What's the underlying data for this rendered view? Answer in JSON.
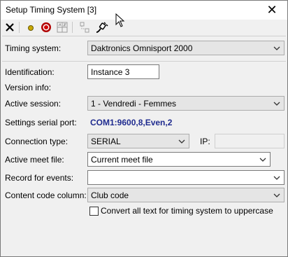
{
  "window": {
    "title": "Setup Timing System [3]"
  },
  "toolbar": {
    "icons": [
      "close-icon",
      "yellow-dot-icon",
      "red-record-icon",
      "number-grid-icon",
      "disconnected-icon",
      "plug-icon"
    ]
  },
  "form": {
    "timing_system": {
      "label": "Timing system:",
      "value": "Daktronics Omnisport 2000"
    },
    "identification": {
      "label": "Identification:",
      "value": "Instance 3"
    },
    "version_info": {
      "label": "Version info:"
    },
    "active_session": {
      "label": "Active session:",
      "value": "1 - Vendredi - Femmes"
    },
    "serial_settings": {
      "label": "Settings serial port:",
      "value": "COM1:9600,8,Even,2"
    },
    "connection_type": {
      "label": "Connection type:",
      "value": "SERIAL"
    },
    "ip": {
      "label": "IP:",
      "value": ""
    },
    "active_meet_file": {
      "label": "Active meet file:",
      "value": "Current meet file"
    },
    "record_events": {
      "label": "Record for events:",
      "value": ""
    },
    "content_code": {
      "label": "Content code column:",
      "value": "Club code"
    },
    "uppercase_checkbox": {
      "label": "Convert all text for timing system to uppercase",
      "checked": false
    }
  }
}
